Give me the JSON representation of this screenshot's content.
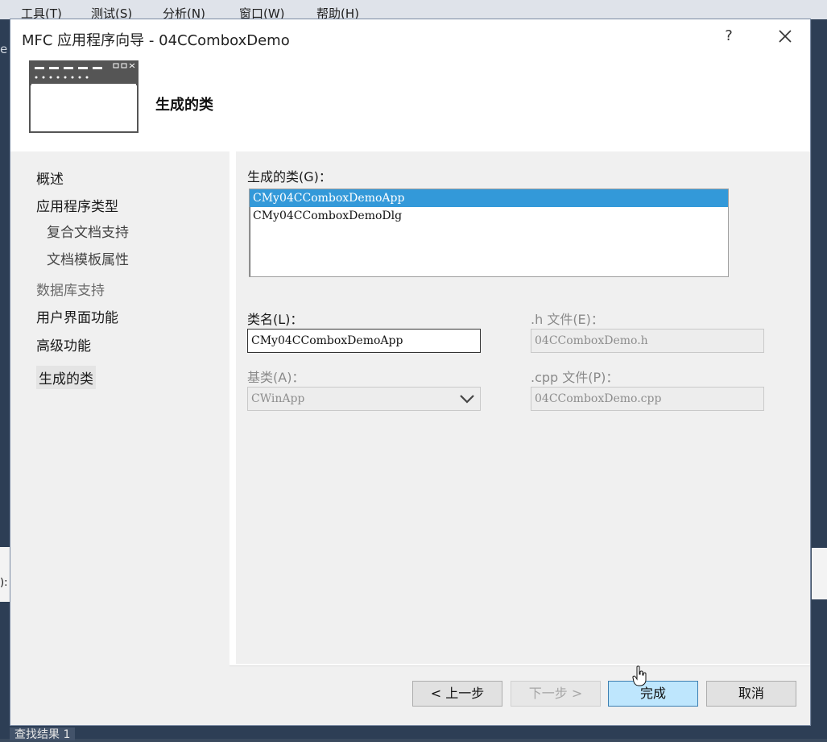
{
  "ide": {
    "menu": [
      "工具(T)",
      "测试(S)",
      "分析(N)",
      "窗口(W)",
      "帮助(H)"
    ],
    "left_edge_text": "e",
    "left_panel_text": "):",
    "bottom_tab": "查找结果 1"
  },
  "dialog": {
    "title": "MFC 应用程序向导 - 04CComboxDemo",
    "help_label": "?",
    "banner_title": "生成的类",
    "nav": [
      {
        "label": "概述",
        "state": "normal"
      },
      {
        "label": "应用程序类型",
        "state": "normal"
      },
      {
        "label": "复合文档支持",
        "state": "sub"
      },
      {
        "label": "文档模板属性",
        "state": "sub"
      },
      {
        "label": "数据库支持",
        "state": "disabled"
      },
      {
        "label": "用户界面功能",
        "state": "normal"
      },
      {
        "label": "高级功能",
        "state": "normal"
      },
      {
        "label": "生成的类",
        "state": "selected"
      }
    ],
    "generated_classes_label": "生成的类(G)：",
    "generated_classes": [
      "CMy04CComboxDemoApp",
      "CMy04CComboxDemoDlg"
    ],
    "selected_class_index": 0,
    "class_name_label": "类名(L)：",
    "class_name_value": "CMy04CComboxDemoApp",
    "h_file_label": ".h 文件(E)：",
    "h_file_value": "04CComboxDemo.h",
    "base_class_label": "基类(A)：",
    "base_class_value": "CWinApp",
    "cpp_file_label": ".cpp 文件(P)：",
    "cpp_file_value": "04CComboxDemo.cpp",
    "buttons": {
      "prev": "< 上一步",
      "next": "下一步 >",
      "finish": "完成",
      "cancel": "取消"
    }
  },
  "colors": {
    "selection": "#3399d9",
    "primary_button": "#bee6fd",
    "ide_frame": "#2d3e55"
  }
}
